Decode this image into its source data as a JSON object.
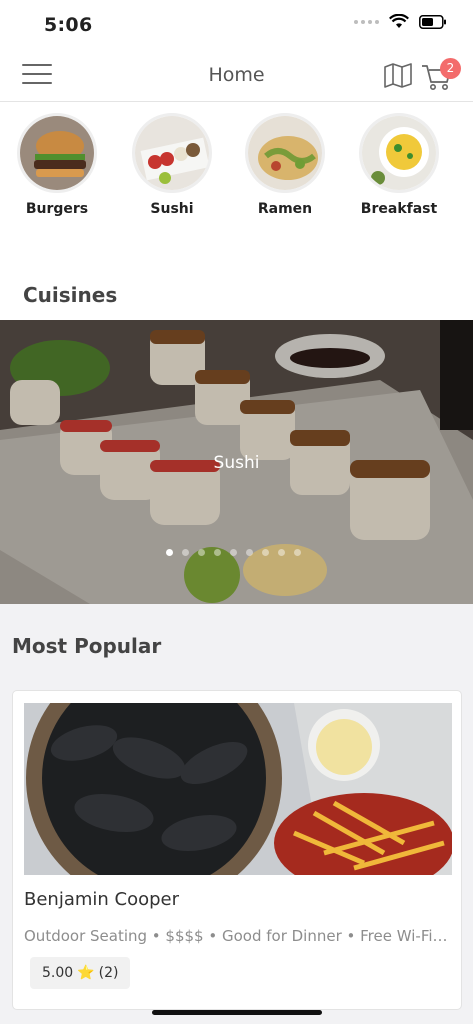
{
  "status_bar": {
    "time": "5:06"
  },
  "nav": {
    "title": "Home",
    "cart_count": "2",
    "icons": [
      "menu-icon",
      "map-icon",
      "cart-icon"
    ]
  },
  "categories": [
    {
      "label": "Burgers"
    },
    {
      "label": "Sushi"
    },
    {
      "label": "Ramen"
    },
    {
      "label": "Breakfast"
    }
  ],
  "cuisines": {
    "title": "Cuisines",
    "hero_label": "Sushi",
    "pages": 9,
    "active_page": 1
  },
  "popular": {
    "title": "Most Popular",
    "card": {
      "name": "Benjamin Cooper",
      "tags": "Outdoor Seating • $$$$ • Good for Dinner • Free Wi-Fi…",
      "rating": "5.00",
      "star": "⭐",
      "reviews": "(2)"
    }
  },
  "colors": {
    "badge": "#f36c6c",
    "page_bg": "#f2f2f4"
  }
}
